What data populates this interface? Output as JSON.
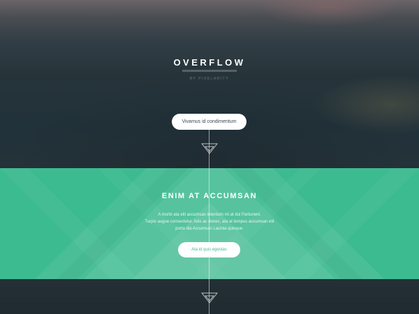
{
  "header": {
    "title": "OVERFLOW",
    "subtitle": "BY PIXELARITY",
    "cta_label": "Vivamus id condimentum"
  },
  "features": {
    "title": "ENIM AT ACCUMSAN",
    "description": [
      "A morbi ata elit accumsan interdum mi at dui Parturient.",
      "Turpis augue consectetur, felis ac donec, ata at tempus accumsan elit",
      "porta dia Accumsan Lacinia quisque."
    ],
    "cta_label": "Ata id quis egestas"
  },
  "colors": {
    "accent": "#3dbb90",
    "dark": "#22323a",
    "button": "#ffffff"
  },
  "icons": [
    "down-triangle-icon",
    "down-triangle-icon"
  ]
}
